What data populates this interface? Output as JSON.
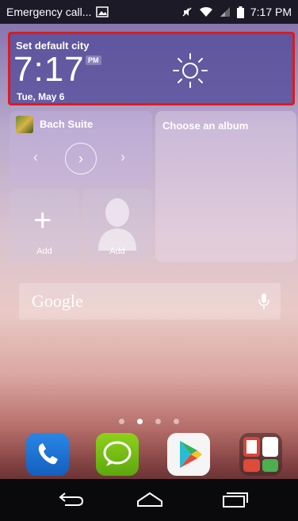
{
  "status_bar": {
    "carrier_text": "Emergency call...",
    "time": "7:17 PM"
  },
  "weather_widget": {
    "city": "Set default city",
    "time": "7:17",
    "ampm": "PM",
    "date": "Tue, May 6",
    "icon": "sun-icon"
  },
  "music_widget": {
    "track": "Bach Suite",
    "prev_glyph": "‹",
    "next_glyph": "›",
    "play_glyph": "›"
  },
  "album_widget": {
    "label": "Choose an album"
  },
  "shortcuts": [
    {
      "label": "Add",
      "icon": "plus-icon"
    },
    {
      "label": "Add",
      "icon": "contact-icon"
    }
  ],
  "search_bar": {
    "logo_text": "Google",
    "icon": "mic-icon"
  },
  "page_indicator": {
    "count": 4,
    "active_index": 1
  },
  "dock": [
    {
      "name": "Phone",
      "icon": "phone-icon"
    },
    {
      "name": "Messaging",
      "icon": "message-icon"
    },
    {
      "name": "Play Store",
      "icon": "play-store-icon"
    },
    {
      "name": "Google folder",
      "icon": "folder-icon"
    }
  ],
  "nav_bar": [
    "back-icon",
    "home-icon",
    "recents-icon"
  ],
  "colors": {
    "highlight": "#e01a1a",
    "weather_bg": "#554e9b"
  }
}
